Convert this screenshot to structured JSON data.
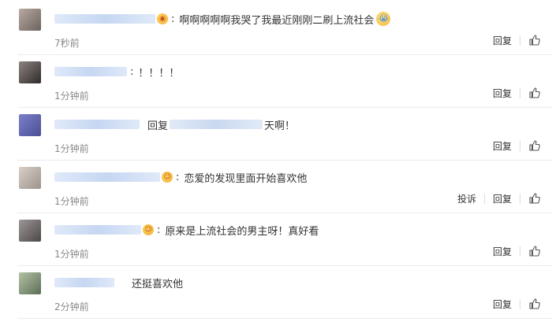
{
  "comments": [
    {
      "text": "啊啊啊啊啊我哭了我最近刚刚二刷上流社会",
      "time": "7秒前",
      "reply": "回复",
      "emoji": "crying-face-icon"
    },
    {
      "text": "！！！！",
      "time": "1分钟前",
      "reply": "回复"
    },
    {
      "reply_prefix": "回复",
      "text": "天啊！",
      "time": "1分钟前",
      "reply": "回复"
    },
    {
      "text": "恋爱的发现里面开始喜欢他",
      "time": "1分钟前",
      "report": "投诉",
      "reply": "回复",
      "emoji": "smiling-face-icon"
    },
    {
      "text": "原来是上流社会的男主呀！真好看",
      "time": "1分钟前",
      "reply": "回复",
      "emoji": "smiling-face-icon"
    },
    {
      "text": "还挺喜欢他",
      "time": "2分钟前",
      "reply": "回复"
    }
  ],
  "colors": {
    "name_blur": "#c6d7f2",
    "time": "#888888",
    "divider": "#ececec"
  }
}
